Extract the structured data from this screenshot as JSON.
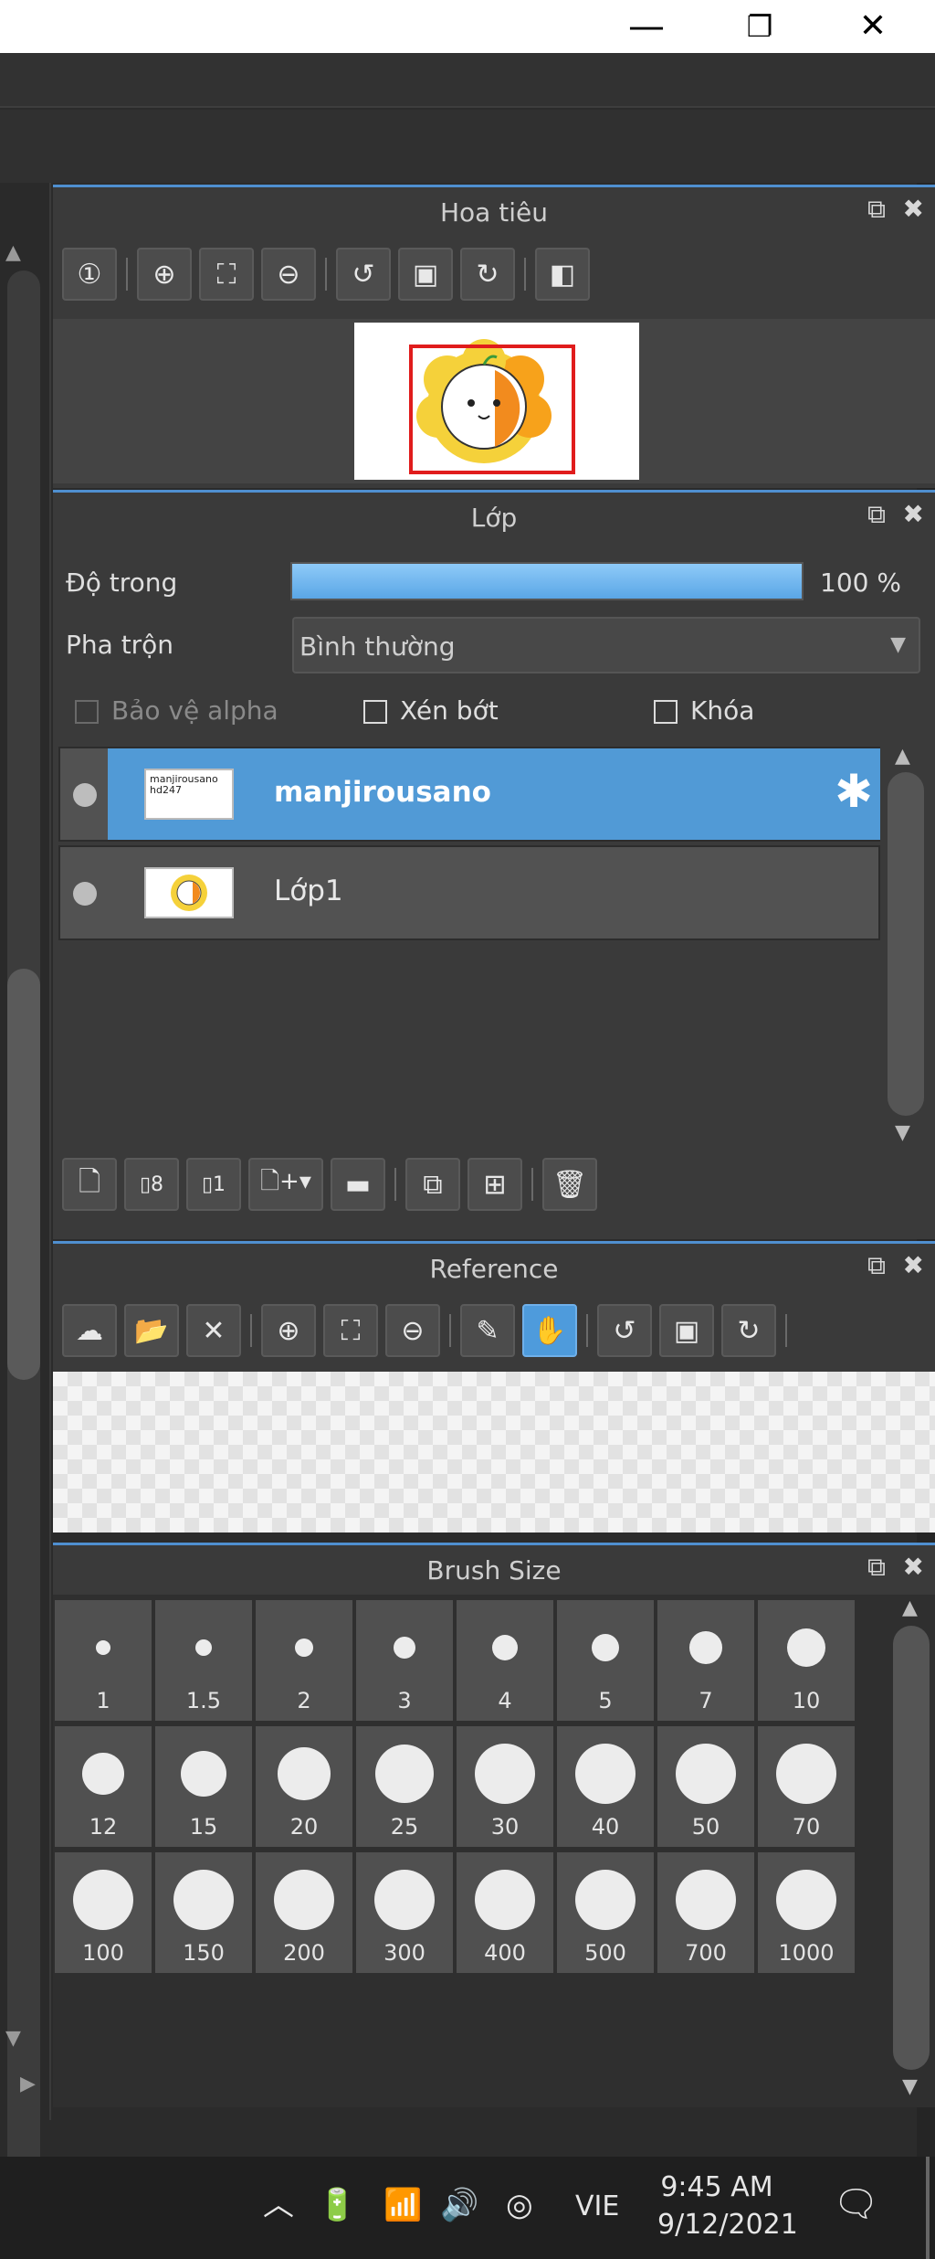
{
  "window": {
    "minimize": "—",
    "restore": "❐",
    "close": "✕"
  },
  "navigator": {
    "title": "Hoa tiêu"
  },
  "layers": {
    "title": "Lớp",
    "opacity_label": "Độ trong",
    "opacity_value": "100 %",
    "opacity_fraction": 1.0,
    "blend_label": "Pha trộn",
    "blend_value": "Bình thường",
    "protect_alpha": "Bảo vệ alpha",
    "clipping": "Xén bớt",
    "lock": "Khóa",
    "items": [
      {
        "name": "manjirousano",
        "thumb_text": "manjirousano\nhd247",
        "selected": true
      },
      {
        "name": "Lớp1",
        "selected": false
      }
    ]
  },
  "reference": {
    "title": "Reference"
  },
  "brush": {
    "title": "Brush Size",
    "sizes": [
      "1",
      "1.5",
      "2",
      "3",
      "4",
      "5",
      "7",
      "10",
      "12",
      "15",
      "20",
      "25",
      "30",
      "40",
      "50",
      "70",
      "100",
      "150",
      "200",
      "300",
      "400",
      "500",
      "700",
      "1000"
    ]
  },
  "taskbar": {
    "language": "VIE",
    "time": "9:45 AM",
    "date": "9/12/2021"
  },
  "colors": {
    "accent": "#4e9bdc",
    "panel": "#3a3a3a",
    "selected_layer": "#519ad6"
  }
}
